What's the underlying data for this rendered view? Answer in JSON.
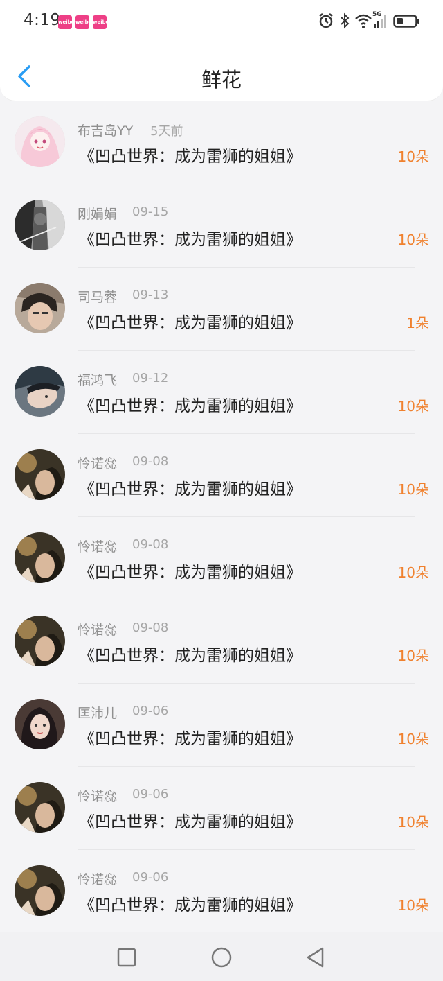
{
  "status_bar": {
    "time": "4:19",
    "notifications": [
      {
        "icon": "weibo-notification-icon",
        "label": "weibo"
      },
      {
        "icon": "weibo-notification-icon",
        "label": "weibo"
      },
      {
        "icon": "weibo-notification-icon",
        "label": "weibo"
      }
    ],
    "network": "5G",
    "icons": [
      "alarm-icon",
      "bluetooth-icon",
      "wifi-icon",
      "signal-icon",
      "battery-icon"
    ]
  },
  "header": {
    "title": "鲜花",
    "back_icon": "chevron-left-icon"
  },
  "colors": {
    "accent": "#2a9df4",
    "count": "#f0812e",
    "name": "#8f8f8f",
    "date": "#a6a6a6"
  },
  "items": [
    {
      "name": "布吉岛YY",
      "date": "5天前",
      "book": "《凹凸世界：成为雷狮的姐姐》",
      "count": "10朵"
    },
    {
      "name": "刚娟娟",
      "date": "09-15",
      "book": "《凹凸世界：成为雷狮的姐姐》",
      "count": "10朵"
    },
    {
      "name": "司马蓉",
      "date": "09-13",
      "book": "《凹凸世界：成为雷狮的姐姐》",
      "count": "1朵"
    },
    {
      "name": "福鸿飞",
      "date": "09-12",
      "book": "《凹凸世界：成为雷狮的姐姐》",
      "count": "10朵"
    },
    {
      "name": "怜诺惢",
      "date": "09-08",
      "book": "《凹凸世界：成为雷狮的姐姐》",
      "count": "10朵"
    },
    {
      "name": "怜诺惢",
      "date": "09-08",
      "book": "《凹凸世界：成为雷狮的姐姐》",
      "count": "10朵"
    },
    {
      "name": "怜诺惢",
      "date": "09-08",
      "book": "《凹凸世界：成为雷狮的姐姐》",
      "count": "10朵"
    },
    {
      "name": "匡沛儿",
      "date": "09-06",
      "book": "《凹凸世界：成为雷狮的姐姐》",
      "count": "10朵"
    },
    {
      "name": "怜诺惢",
      "date": "09-06",
      "book": "《凹凸世界：成为雷狮的姐姐》",
      "count": "10朵"
    },
    {
      "name": "怜诺惢",
      "date": "09-06",
      "book": "《凹凸世界：成为雷狮的姐姐》",
      "count": "10朵"
    }
  ],
  "system_nav": [
    "recent-apps-icon",
    "home-icon",
    "back-icon"
  ]
}
